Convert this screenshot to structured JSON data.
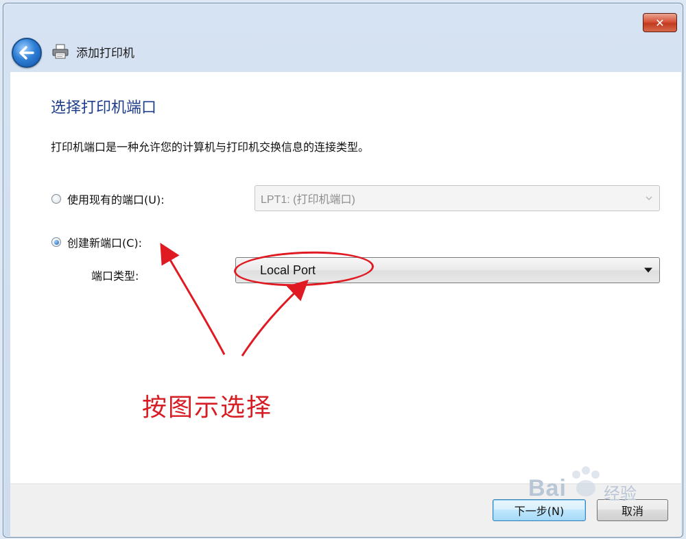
{
  "window": {
    "title": "添加打印机",
    "close_glyph": "✕"
  },
  "page": {
    "section_title": "选择打印机端口",
    "description": "打印机端口是一种允许您的计算机与打印机交换信息的连接类型。"
  },
  "options": {
    "use_existing": {
      "label": "使用现有的端口(U):",
      "selected": false,
      "select_value": "LPT1: (打印机端口)"
    },
    "create_new": {
      "label": "创建新端口(C):",
      "selected": true,
      "port_type_label": "端口类型:",
      "select_value": "Local Port"
    }
  },
  "annotation": {
    "text": "按图示选择",
    "color": "#d71d24"
  },
  "footer": {
    "next_label": "下一步(N)",
    "cancel_label": "取消"
  },
  "watermark": {
    "text": "Bai",
    "text_cn": "经验"
  },
  "icons": {
    "back": "back-arrow-icon",
    "printer": "printer-icon",
    "close": "close-icon",
    "dropdown": "chevron-down-icon"
  }
}
